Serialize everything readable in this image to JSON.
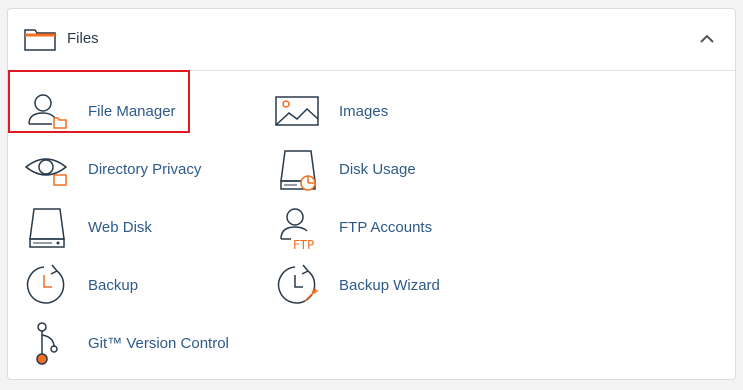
{
  "section": {
    "title": "Files",
    "icon": "folder-icon",
    "collapse_icon": "chevron-up-icon"
  },
  "items": [
    {
      "label": "File Manager",
      "icon": "file-manager-icon"
    },
    {
      "label": "Images",
      "icon": "images-icon"
    },
    {
      "label": "Directory Privacy",
      "icon": "directory-privacy-icon"
    },
    {
      "label": "Disk Usage",
      "icon": "disk-usage-icon"
    },
    {
      "label": "Web Disk",
      "icon": "web-disk-icon"
    },
    {
      "label": "FTP Accounts",
      "icon": "ftp-accounts-icon"
    },
    {
      "label": "Backup",
      "icon": "backup-icon"
    },
    {
      "label": "Backup Wizard",
      "icon": "backup-wizard-icon"
    },
    {
      "label": "Git™ Version Control",
      "icon": "git-version-control-icon"
    }
  ],
  "ftp_icon_text": "FTP",
  "colors": {
    "link": "#2e5a8a",
    "icon_stroke": "#293a4a",
    "accent": "#f26f21",
    "highlight": "#e0181f"
  }
}
